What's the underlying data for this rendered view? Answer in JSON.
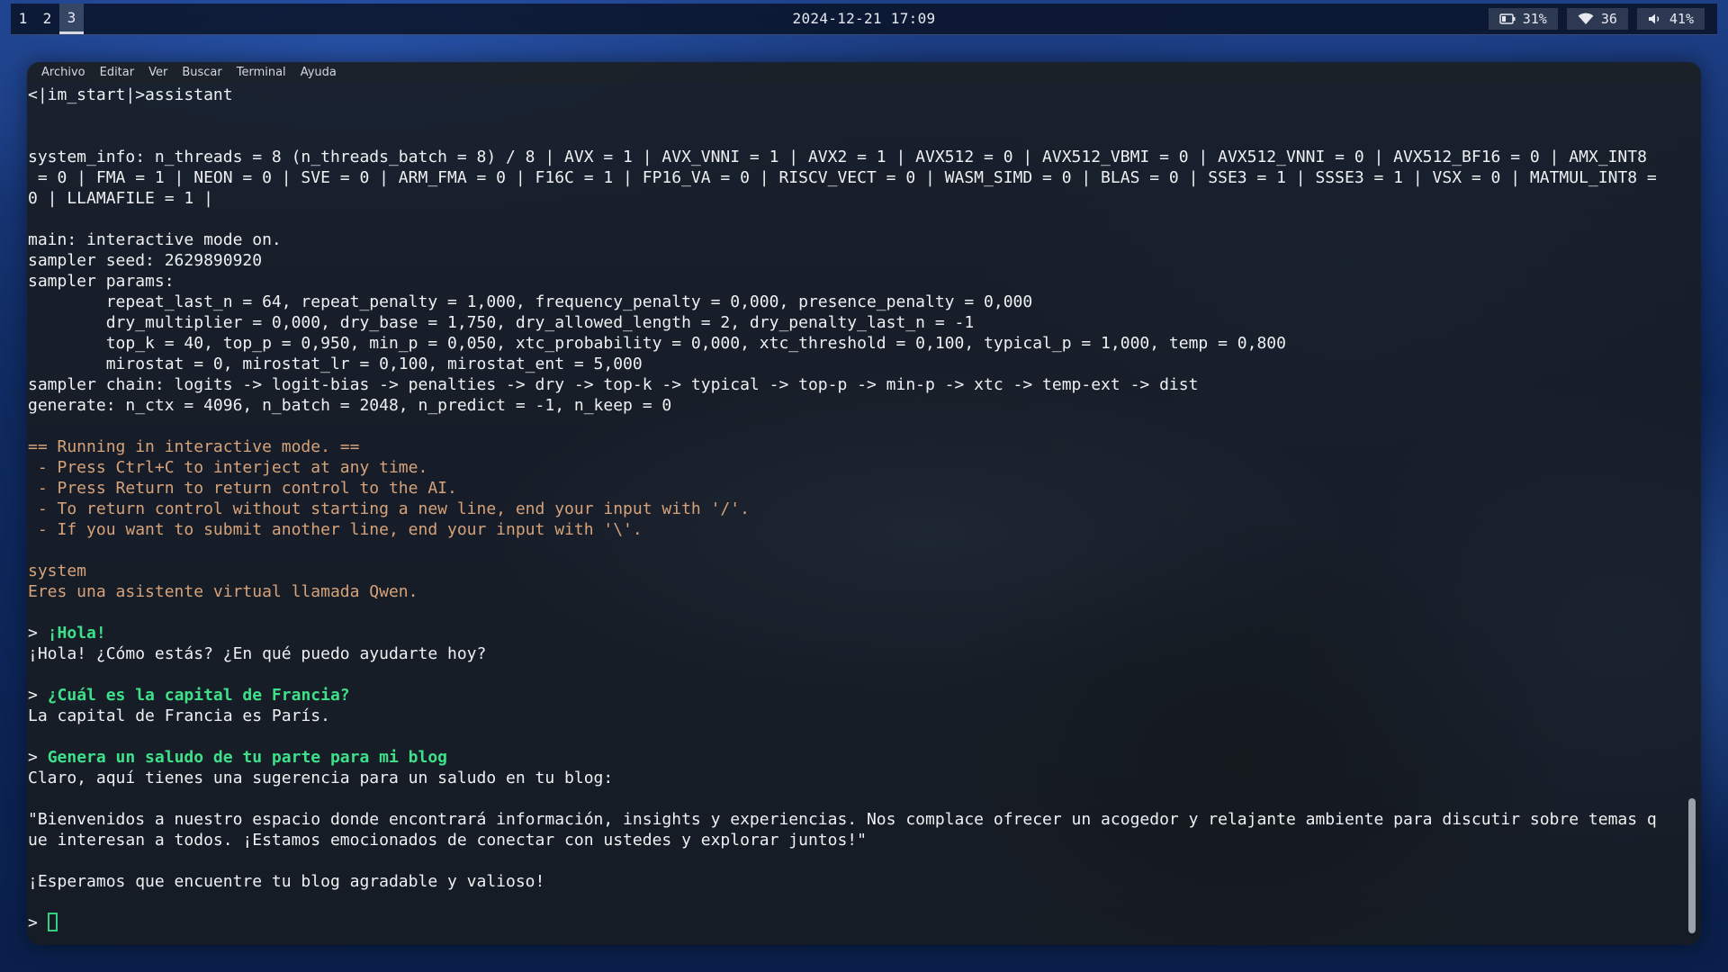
{
  "topbar": {
    "workspaces": [
      "1",
      "2",
      "3"
    ],
    "active_workspace": "3",
    "clock": "2024-12-21 17:09",
    "battery": {
      "icon": "battery-icon",
      "value": "31%"
    },
    "wifi": {
      "icon": "wifi-icon",
      "value": "36"
    },
    "volume": {
      "icon": "volume-icon",
      "value": "41%"
    }
  },
  "terminal": {
    "menu": [
      "Archivo",
      "Editar",
      "Ver",
      "Buscar",
      "Terminal",
      "Ayuda"
    ],
    "lines": [
      {
        "text": "<|im_start|>assistant",
        "style": "normal"
      },
      {
        "text": "",
        "style": "normal"
      },
      {
        "text": "",
        "style": "normal"
      },
      {
        "text": "system_info: n_threads = 8 (n_threads_batch = 8) / 8 | AVX = 1 | AVX_VNNI = 1 | AVX2 = 1 | AVX512 = 0 | AVX512_VBMI = 0 | AVX512_VNNI = 0 | AVX512_BF16 = 0 | AMX_INT8",
        "style": "normal"
      },
      {
        "text": " = 0 | FMA = 1 | NEON = 0 | SVE = 0 | ARM_FMA = 0 | F16C = 1 | FP16_VA = 0 | RISCV_VECT = 0 | WASM_SIMD = 0 | BLAS = 0 | SSE3 = 1 | SSSE3 = 1 | VSX = 0 | MATMUL_INT8 =",
        "style": "normal"
      },
      {
        "text": "0 | LLAMAFILE = 1 |",
        "style": "normal"
      },
      {
        "text": "",
        "style": "normal"
      },
      {
        "text": "main: interactive mode on.",
        "style": "normal"
      },
      {
        "text": "sampler seed: 2629890920",
        "style": "normal"
      },
      {
        "text": "sampler params:",
        "style": "normal"
      },
      {
        "text": "        repeat_last_n = 64, repeat_penalty = 1,000, frequency_penalty = 0,000, presence_penalty = 0,000",
        "style": "normal"
      },
      {
        "text": "        dry_multiplier = 0,000, dry_base = 1,750, dry_allowed_length = 2, dry_penalty_last_n = -1",
        "style": "normal"
      },
      {
        "text": "        top_k = 40, top_p = 0,950, min_p = 0,050, xtc_probability = 0,000, xtc_threshold = 0,100, typical_p = 1,000, temp = 0,800",
        "style": "normal"
      },
      {
        "text": "        mirostat = 0, mirostat_lr = 0,100, mirostat_ent = 5,000",
        "style": "normal"
      },
      {
        "text": "sampler chain: logits -> logit-bias -> penalties -> dry -> top-k -> typical -> top-p -> min-p -> xtc -> temp-ext -> dist",
        "style": "normal"
      },
      {
        "text": "generate: n_ctx = 4096, n_batch = 2048, n_predict = -1, n_keep = 0",
        "style": "normal"
      },
      {
        "text": "",
        "style": "normal"
      },
      {
        "text": "== Running in interactive mode. ==",
        "style": "orange"
      },
      {
        "text": " - Press Ctrl+C to interject at any time.",
        "style": "orange"
      },
      {
        "text": " - Press Return to return control to the AI.",
        "style": "orange"
      },
      {
        "text": " - To return control without starting a new line, end your input with '/'.",
        "style": "orange"
      },
      {
        "text": " - If you want to submit another line, end your input with '\\'.",
        "style": "orange"
      },
      {
        "text": "",
        "style": "normal"
      },
      {
        "text": "system",
        "style": "orange"
      },
      {
        "text": "Eres una asistente virtual llamada Qwen.",
        "style": "orange"
      },
      {
        "text": "",
        "style": "normal"
      },
      {
        "prompt": "> ",
        "text": "¡Hola!",
        "style": "user"
      },
      {
        "text": "¡Hola! ¿Cómo estás? ¿En qué puedo ayudarte hoy?",
        "style": "normal"
      },
      {
        "text": "",
        "style": "normal"
      },
      {
        "prompt": "> ",
        "text": "¿Cuál es la capital de Francia?",
        "style": "user"
      },
      {
        "text": "La capital de Francia es París.",
        "style": "normal"
      },
      {
        "text": "",
        "style": "normal"
      },
      {
        "prompt": "> ",
        "text": "Genera un saludo de tu parte para mi blog",
        "style": "user"
      },
      {
        "text": "Claro, aquí tienes una sugerencia para un saludo en tu blog:",
        "style": "normal"
      },
      {
        "text": "",
        "style": "normal"
      },
      {
        "text": "\"Bienvenidos a nuestro espacio donde encontrará información, insights y experiencias. Nos complace ofrecer un acogedor y relajante ambiente para discutir sobre temas q",
        "style": "normal"
      },
      {
        "text": "ue interesan a todos. ¡Estamos emocionados de conectar con ustedes y explorar juntos!\"",
        "style": "normal"
      },
      {
        "text": "",
        "style": "normal"
      },
      {
        "text": "¡Esperamos que encuentre tu blog agradable y valioso!",
        "style": "normal"
      },
      {
        "text": "",
        "style": "normal"
      },
      {
        "prompt": "> ",
        "text": "",
        "style": "input"
      }
    ]
  },
  "colors": {
    "user_prompt": "#3ee08a",
    "info_text": "#d6a27a",
    "default_text": "#eef0f2"
  }
}
